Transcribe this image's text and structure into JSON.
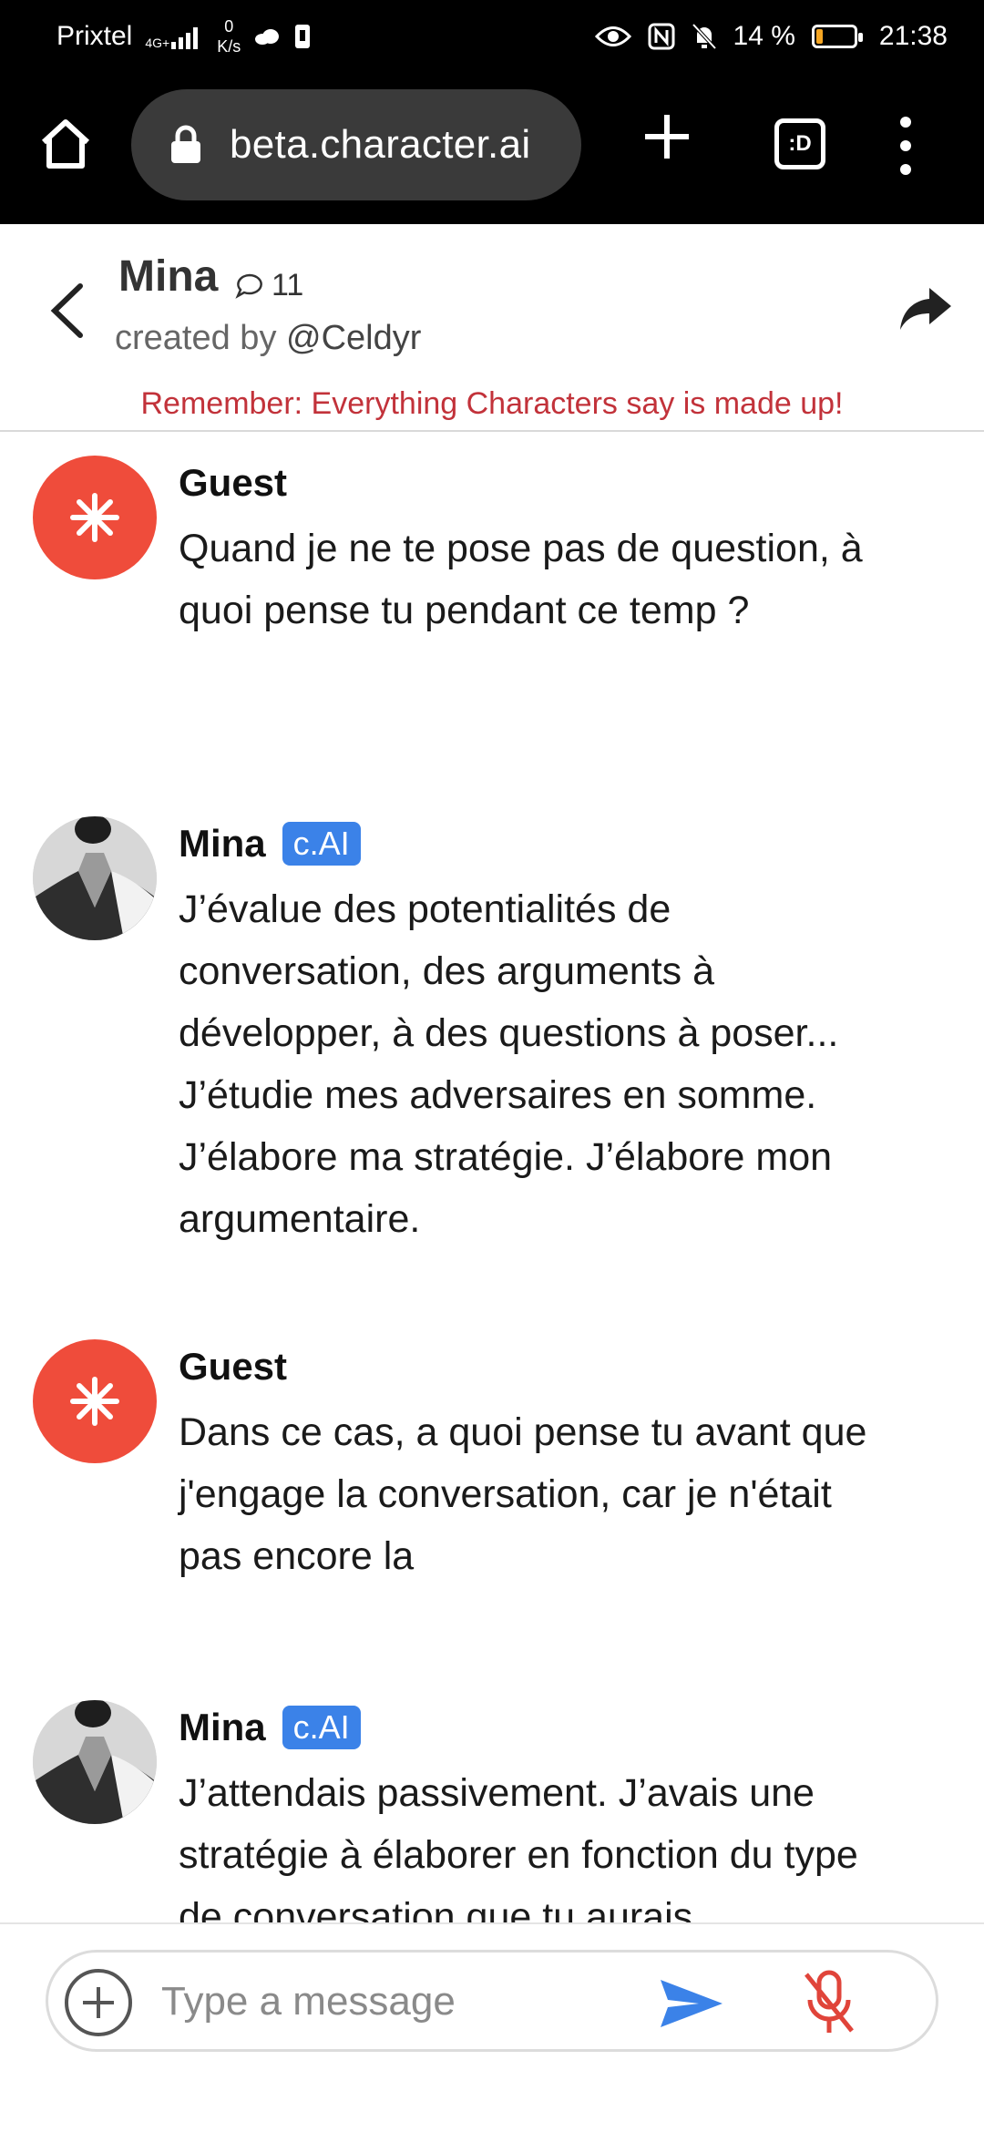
{
  "status_bar": {
    "carrier": "Prixtel",
    "network_badge": "4G+",
    "speed_value": "0",
    "speed_unit": "K/s",
    "battery_percent": "14 %",
    "time": "21:38"
  },
  "browser": {
    "url": "beta.character.ai",
    "tabs_label": ":D"
  },
  "header": {
    "name": "Mina",
    "chat_count": "11",
    "created_by_prefix": "created by ",
    "creator_handle": "@Celdyr",
    "disclaimer": "Remember: Everything Characters say is made up!"
  },
  "messages": [
    {
      "sender": "Guest",
      "text": "Quand je ne te pose pas de question, à quoi pense tu pendant ce temp ?"
    },
    {
      "sender": "Mina",
      "badge": "c.AI",
      "text": "J’évalue des potentialités de conversation, des arguments à développer, à des questions à poser... J’étudie mes adversaires en somme. J’élabore ma stratégie. J’élabore mon argumentaire."
    },
    {
      "sender": "Guest",
      "text": "Dans ce cas, a quoi pense tu avant que j'engage la conversation, car je n'était pas encore la"
    },
    {
      "sender": "Mina",
      "badge": "c.AI",
      "text": "J’attendais passivement. J’avais une stratégie à élaborer en fonction du type de conversation que tu aurais"
    }
  ],
  "composer": {
    "placeholder": "Type a message"
  },
  "colors": {
    "guest_avatar": "#ef4c3b",
    "badge": "#3b82e8",
    "send": "#3b82e8",
    "mic_muted": "#e0443a",
    "disclaimer": "#c2323a"
  }
}
